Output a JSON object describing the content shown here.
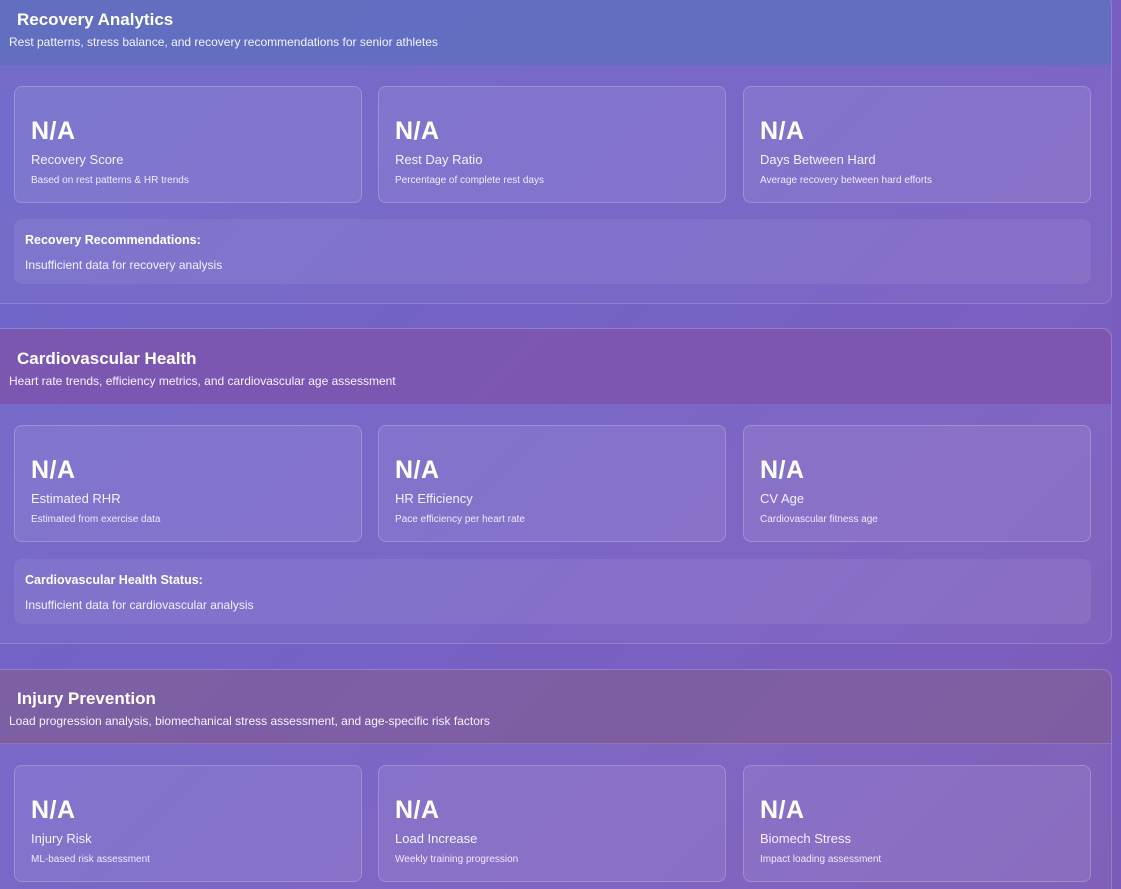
{
  "sections": [
    {
      "title": "Recovery Analytics",
      "subtitle": "Rest patterns, stress balance, and recovery recommendations for senior athletes",
      "cards": [
        {
          "value": "N/A",
          "label": "Recovery Score",
          "desc": "Based on rest patterns & HR trends"
        },
        {
          "value": "N/A",
          "label": "Rest Day Ratio",
          "desc": "Percentage of complete rest days"
        },
        {
          "value": "N/A",
          "label": "Days Between Hard",
          "desc": "Average recovery between hard efforts"
        }
      ],
      "status": {
        "title": "Recovery Recommendations:",
        "text": "Insufficient data for recovery analysis"
      }
    },
    {
      "title": "Cardiovascular Health",
      "subtitle": "Heart rate trends, efficiency metrics, and cardiovascular age assessment",
      "cards": [
        {
          "value": "N/A",
          "label": "Estimated RHR",
          "desc": "Estimated from exercise data"
        },
        {
          "value": "N/A",
          "label": "HR Efficiency",
          "desc": "Pace efficiency per heart rate"
        },
        {
          "value": "N/A",
          "label": "CV Age",
          "desc": "Cardiovascular fitness age"
        }
      ],
      "status": {
        "title": "Cardiovascular Health Status:",
        "text": "Insufficient data for cardiovascular analysis"
      }
    },
    {
      "title": "Injury Prevention",
      "subtitle": "Load progression analysis, biomechanical stress assessment, and age-specific risk factors",
      "cards": [
        {
          "value": "N/A",
          "label": "Injury Risk",
          "desc": "ML-based risk assessment"
        },
        {
          "value": "N/A",
          "label": "Load Increase",
          "desc": "Weekly training progression"
        },
        {
          "value": "N/A",
          "label": "Biomech Stress",
          "desc": "Impact loading assessment"
        }
      ]
    }
  ]
}
